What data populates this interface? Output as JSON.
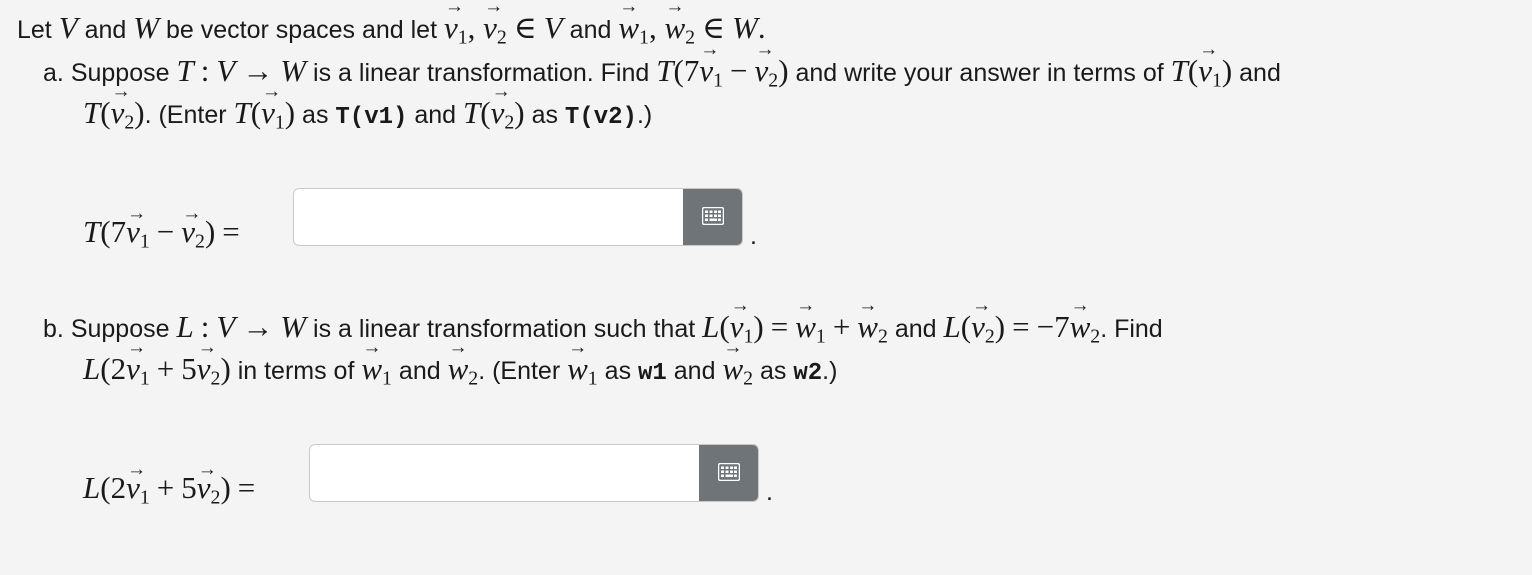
{
  "intro": {
    "t1": "Let ",
    "V": "V",
    "t2": " and ",
    "W": "W",
    "t3": " be vector spaces and let ",
    "v": "v",
    "w": "w",
    "sub1": "1",
    "sub2": "2",
    "comma": ",",
    "in_sym": "∈",
    "t4": " and ",
    "dot": "."
  },
  "part_a": {
    "marker": "a.",
    "t1": "Suppose ",
    "T": "T",
    "colon": ":",
    "V": "V",
    "arrow": "→",
    "W": "W",
    "t2": " is a linear transformation. Find ",
    "coef": "7",
    "minus": "−",
    "t3": " and write your answer in terms of ",
    "t4": " and",
    "t5": ". (Enter ",
    "t6": " as ",
    "code1": "T(v1)",
    "t7": " and ",
    "t8": " as ",
    "code2": "T(v2)",
    "t9": ".)",
    "equals": "=",
    "answer_value": "",
    "period": "."
  },
  "part_b": {
    "marker": "b.",
    "t1": "Suppose ",
    "L": "L",
    "colon": ":",
    "V": "V",
    "arrow": "→",
    "W": "W",
    "t2": " is a linear transformation such that ",
    "equals": "=",
    "plus": "+",
    "t3": " and ",
    "neg7": "−7",
    "t4": ". Find",
    "coef1": "2",
    "coef2": "5",
    "t5": " in terms of ",
    "t6": " and ",
    "t7": ". (Enter ",
    "t8": " as ",
    "code1": "w1",
    "t9": " and ",
    "t10": " as ",
    "code2": "w2",
    "t11": ".)",
    "answer_value": "",
    "period": "."
  },
  "icons": {
    "keyboard": "keyboard-icon"
  },
  "colors": {
    "background": "#f4f4f4",
    "button": "#6f7478",
    "border": "#c9c9c9"
  }
}
